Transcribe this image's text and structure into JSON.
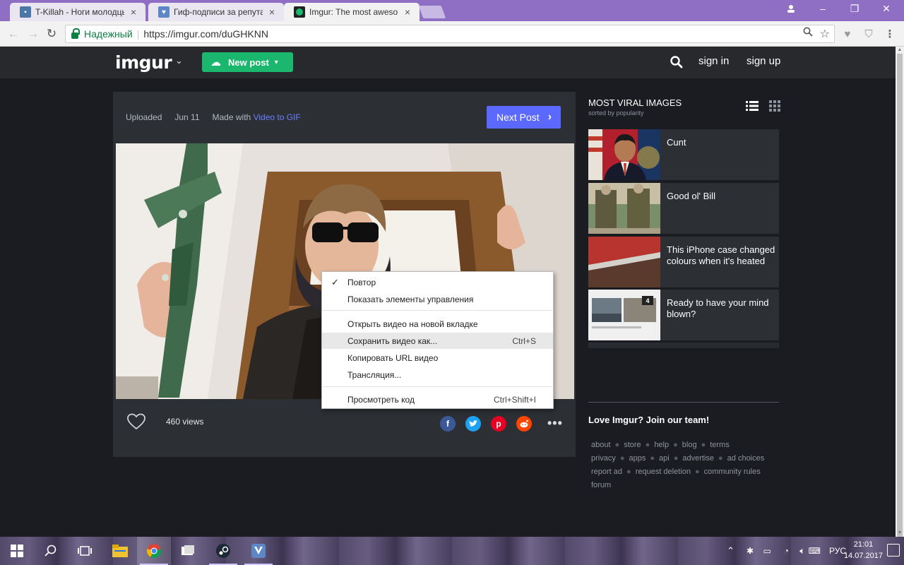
{
  "browser": {
    "tabs": [
      {
        "title": "T-Killah - Ноги молодцы",
        "favicon_color": "#4a76a8",
        "favicon_glyph": "chat-icon",
        "active": false
      },
      {
        "title": "Гиф-подписи за репутацию",
        "favicon_color": "#5d87c5",
        "favicon_glyph": "shield-icon",
        "active": false
      },
      {
        "title": "Imgur: The most awesome images on the Internet",
        "favicon_color": "#1bb76e",
        "favicon_glyph": "imgur-dot-icon",
        "active": true
      }
    ],
    "omnibox": {
      "secure_label": "Надежный",
      "url": "https://imgur.com/duGHKNN"
    }
  },
  "imgur": {
    "logo": "imgur",
    "new_post": "New post",
    "sign_in": "sign in",
    "sign_up": "sign up",
    "post": {
      "uploaded_label": "Uploaded",
      "date": "Jun 11",
      "made_with_label": "Made with",
      "made_with_link": "Video to GIF",
      "next_post": "Next Post",
      "views": "460 views"
    },
    "context_menu": {
      "items": [
        {
          "label": "Повтор",
          "checked": true,
          "shortcut": ""
        },
        {
          "label": "Показать элементы управления",
          "checked": false,
          "shortcut": ""
        },
        {
          "label": "Открыть видео на новой вкладке",
          "checked": false,
          "shortcut": ""
        },
        {
          "label": "Сохранить видео как...",
          "checked": false,
          "shortcut": "Ctrl+S",
          "hover": true
        },
        {
          "label": "Копировать URL видео",
          "checked": false,
          "shortcut": ""
        },
        {
          "label": "Трансляция...",
          "checked": false,
          "shortcut": ""
        },
        {
          "label": "Просмотреть код",
          "checked": false,
          "shortcut": "Ctrl+Shift+I"
        }
      ]
    },
    "sidebar": {
      "title": "MOST VIRAL IMAGES",
      "subtitle": "sorted by popularity",
      "cards": [
        {
          "title": "Cunt"
        },
        {
          "title": "Good ol' Bill"
        },
        {
          "title": "This iPhone case changed colours when it's heated"
        },
        {
          "title": "Ready to have your mind blown?",
          "badge": "4"
        }
      ],
      "join": "Love Imgur? Join our team!",
      "footer_links": [
        "about",
        "store",
        "help",
        "blog",
        "terms",
        "privacy",
        "apps",
        "api",
        "advertise",
        "ad choices",
        "report ad",
        "request deletion",
        "community rules",
        "forum"
      ]
    }
  },
  "taskbar": {
    "language": "РУС",
    "time": "21:01",
    "date": "14.07.2017"
  },
  "colors": {
    "accent_green": "#1bb76e",
    "accent_blue": "#5c69ff",
    "bg": "#1b1c21",
    "panel": "#2c2f34"
  }
}
